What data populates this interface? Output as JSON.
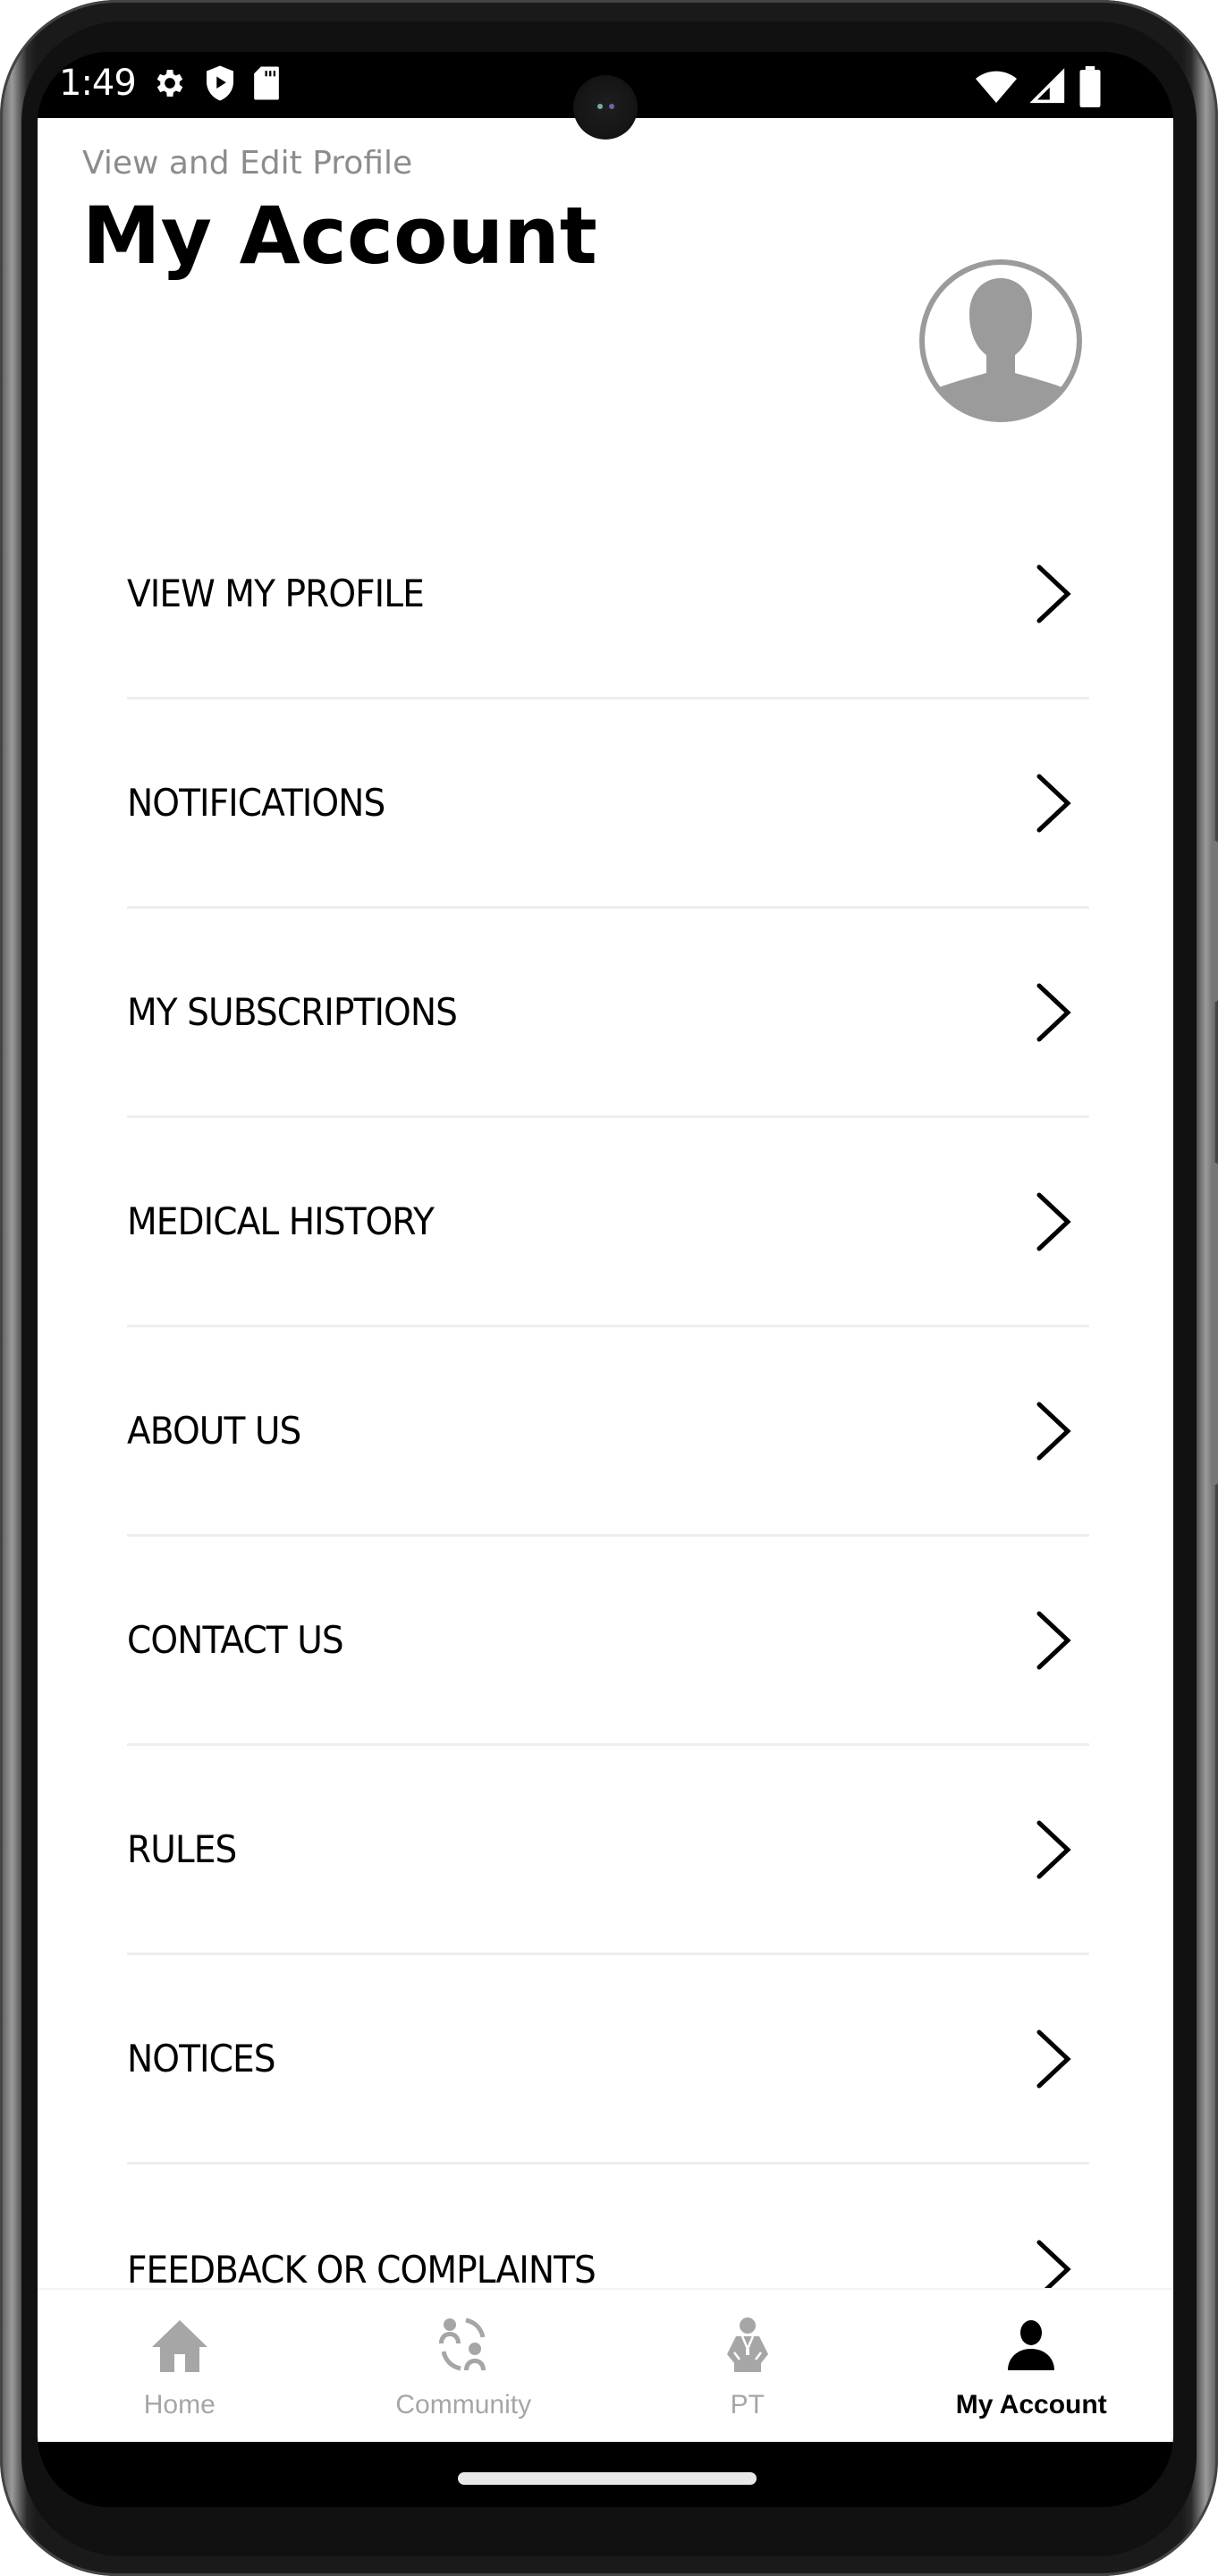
{
  "status_bar": {
    "time": "1:49",
    "left_icons": [
      "gear-icon",
      "shield-play-icon",
      "sd-card-icon"
    ],
    "right_icons": [
      "wifi-icon",
      "cellular-signal-icon",
      "battery-icon"
    ]
  },
  "header": {
    "subtitle": "View and Edit Profile",
    "title": "My Account",
    "avatar_icon": "default-avatar-icon"
  },
  "menu": {
    "items": [
      {
        "label": "VIEW MY PROFILE"
      },
      {
        "label": "NOTIFICATIONS"
      },
      {
        "label": "MY SUBSCRIPTIONS"
      },
      {
        "label": "MEDICAL HISTORY"
      },
      {
        "label": "ABOUT US"
      },
      {
        "label": "CONTACT US"
      },
      {
        "label": "RULES"
      },
      {
        "label": "NOTICES"
      },
      {
        "label": "FEEDBACK OR COMPLAINTS"
      }
    ],
    "chevron_icon": "chevron-right-icon"
  },
  "bottom_nav": {
    "items": [
      {
        "label": "Home",
        "icon": "home-icon",
        "active": false
      },
      {
        "label": "Community",
        "icon": "community-icon",
        "active": false
      },
      {
        "label": "PT",
        "icon": "trainer-icon",
        "active": false
      },
      {
        "label": "My Account",
        "icon": "account-icon",
        "active": true
      }
    ],
    "active_color": "#000000",
    "inactive_color": "#a6a6a6"
  }
}
